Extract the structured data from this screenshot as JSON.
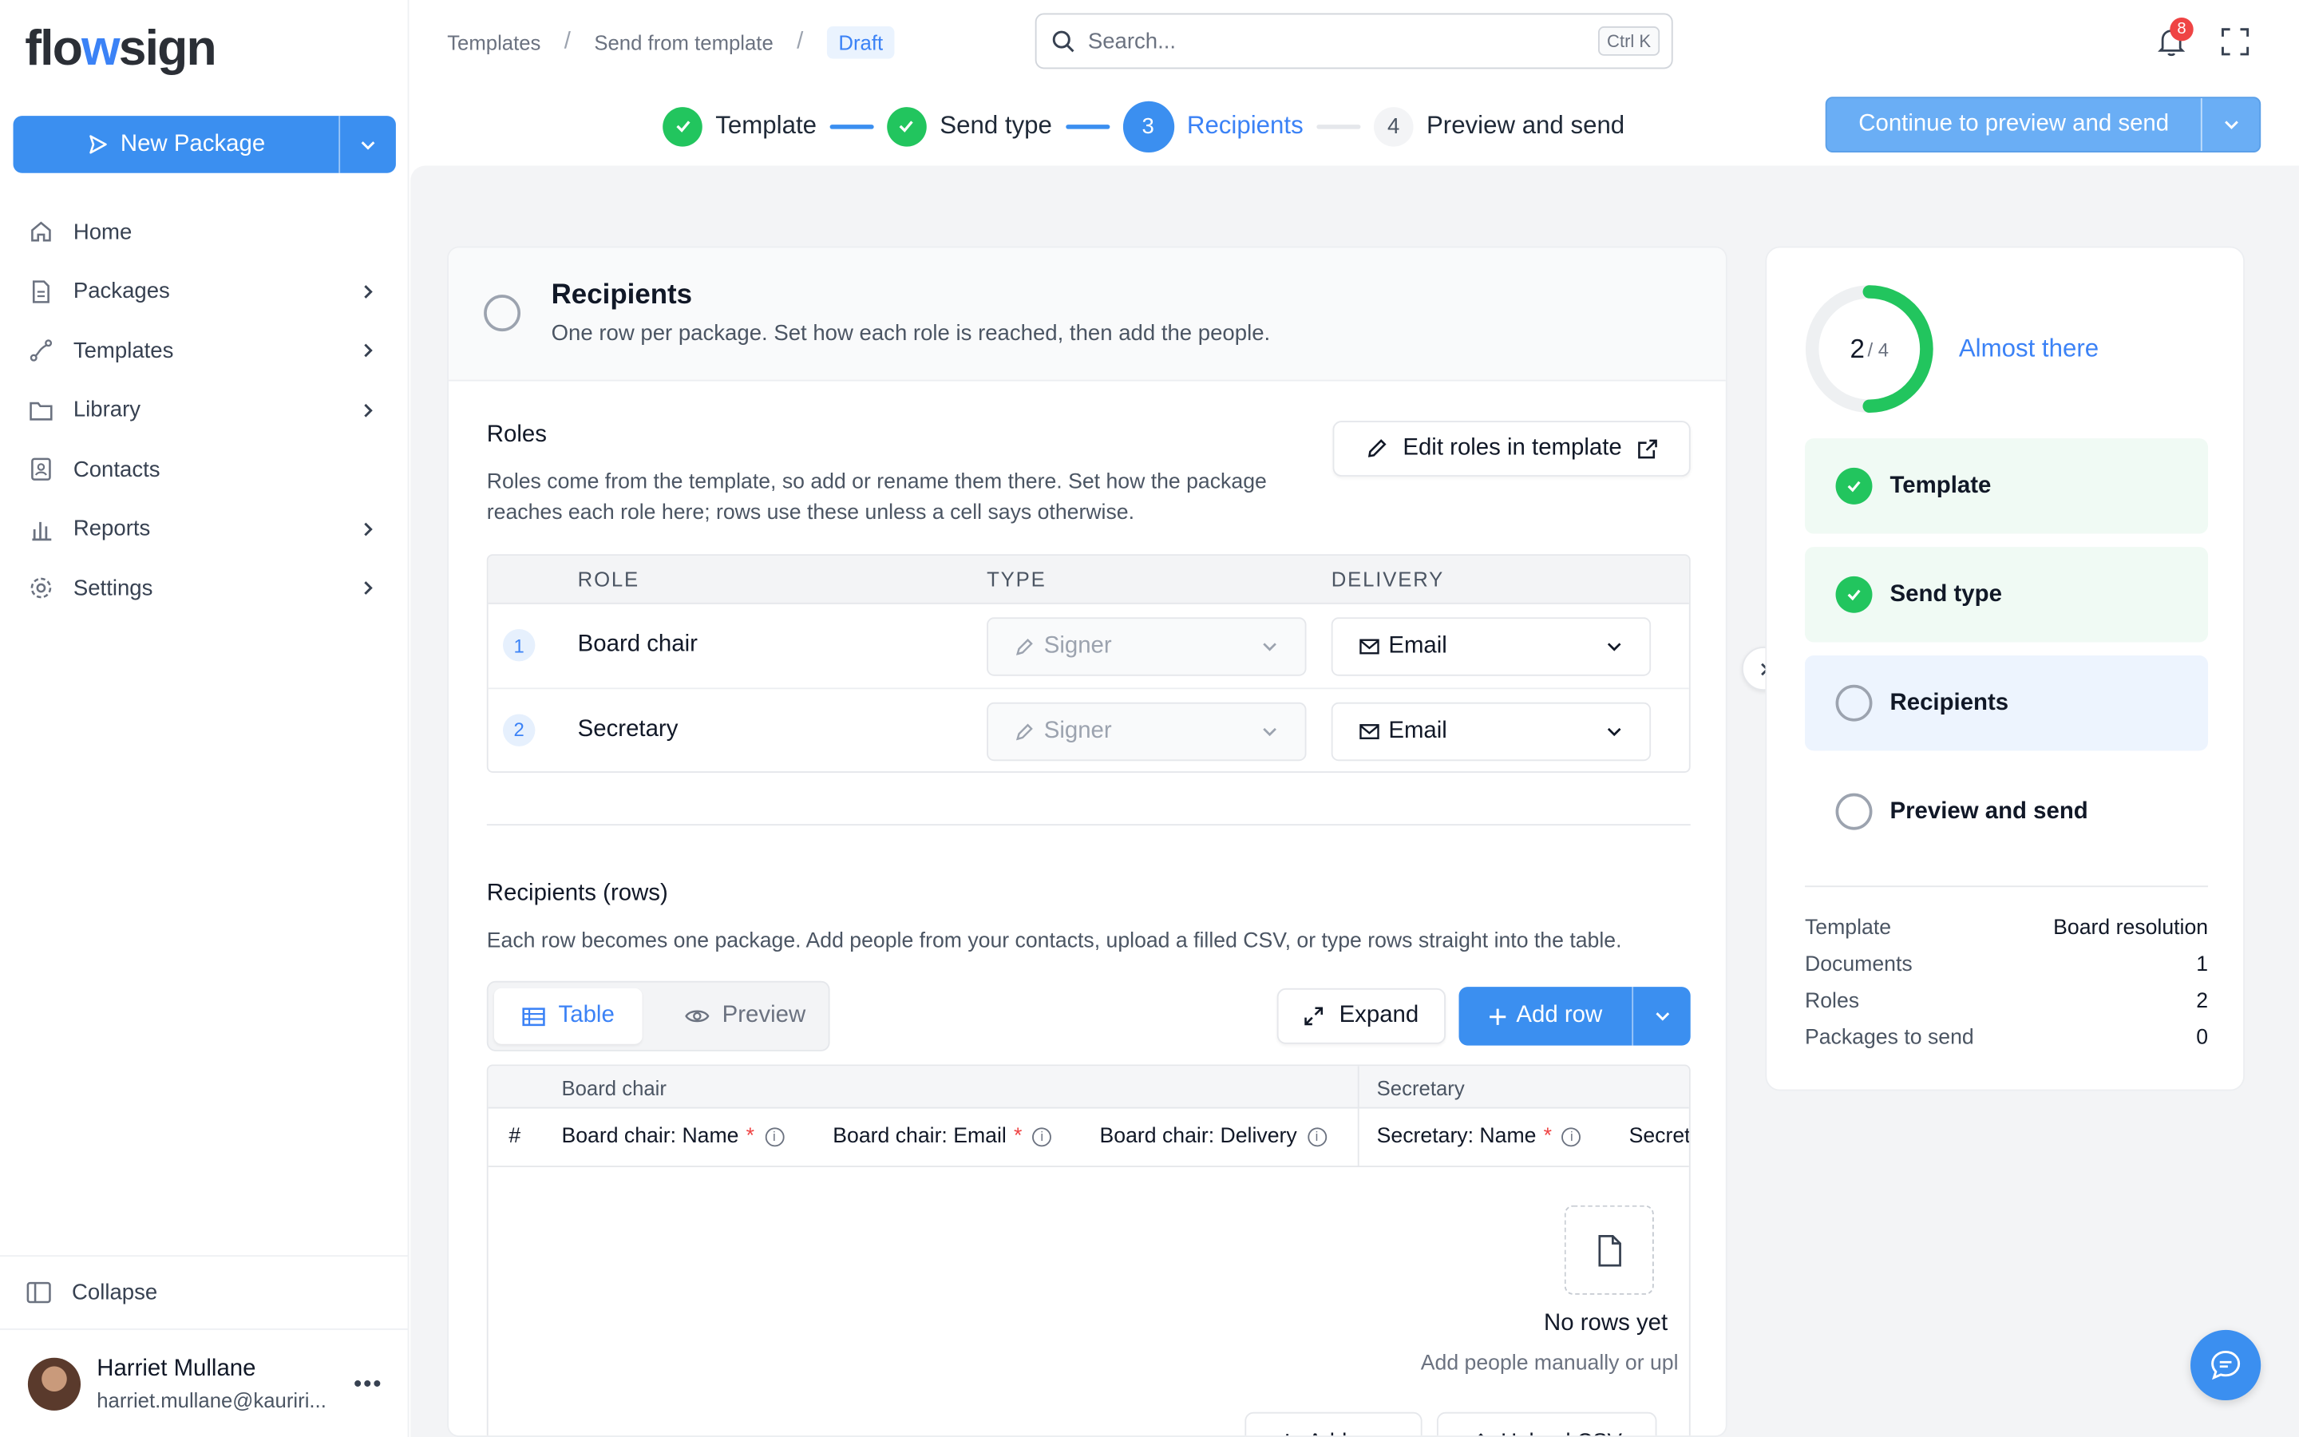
{
  "app": {
    "logo_prefix": "flo",
    "logo_w": "w",
    "logo_suffix": "sign"
  },
  "sidebar": {
    "new_package": "New Package",
    "items": [
      {
        "label": "Home",
        "icon": "home-icon",
        "has_chevron": false
      },
      {
        "label": "Packages",
        "icon": "document-icon",
        "has_chevron": true
      },
      {
        "label": "Templates",
        "icon": "route-icon",
        "has_chevron": true
      },
      {
        "label": "Library",
        "icon": "folder-icon",
        "has_chevron": true
      },
      {
        "label": "Contacts",
        "icon": "contact-book-icon",
        "has_chevron": false
      },
      {
        "label": "Reports",
        "icon": "bar-chart-icon",
        "has_chevron": true
      },
      {
        "label": "Settings",
        "icon": "gear-icon",
        "has_chevron": true
      }
    ],
    "collapse": "Collapse",
    "user": {
      "name": "Harriet Mullane",
      "email": "harriet.mullane@kauriri..."
    }
  },
  "header": {
    "breadcrumb": [
      "Templates",
      "Send from template",
      "Draft"
    ],
    "search_placeholder": "Search...",
    "search_shortcut": "Ctrl K",
    "notifications": "8"
  },
  "stepper": {
    "steps": [
      {
        "label": "Template",
        "state": "done"
      },
      {
        "label": "Send type",
        "state": "done"
      },
      {
        "number": "3",
        "label": "Recipients",
        "state": "current"
      },
      {
        "number": "4",
        "label": "Preview and send",
        "state": "todo"
      }
    ],
    "continue_label": "Continue to preview and send"
  },
  "recipients_card": {
    "title": "Recipients",
    "subtitle": "One row per package. Set how each role is reached, then add the people.",
    "roles": {
      "title": "Roles",
      "description": "Roles come from the template, so add or rename them there. Set how the package reaches each role here; rows use these unless a cell says otherwise.",
      "edit_button": "Edit roles in template",
      "columns": [
        "ROLE",
        "TYPE",
        "DELIVERY"
      ],
      "rows": [
        {
          "num": "1",
          "role": "Board chair",
          "type": "Signer",
          "delivery": "Email"
        },
        {
          "num": "2",
          "role": "Secretary",
          "type": "Signer",
          "delivery": "Email"
        }
      ]
    },
    "rows_section": {
      "title": "Recipients (rows)",
      "description": "Each row becomes one package. Add people from your contacts, upload a filled CSV, or type rows straight into the table.",
      "view_table": "Table",
      "view_preview": "Preview",
      "expand": "Expand",
      "add_row": "Add row",
      "groups": [
        "Board chair",
        "Secretary"
      ],
      "columns": [
        "#",
        "Board chair: Name",
        "Board chair: Email",
        "Board chair: Delivery",
        "Secretary: Name",
        "Secret"
      ],
      "empty_title": "No rows yet",
      "empty_subtitle": "Add people manually or upl",
      "empty_add": "Add row",
      "empty_upload": "Upload CSV"
    }
  },
  "progress_panel": {
    "done": "2",
    "total": "/ 4",
    "progress_fraction": 0.5,
    "status": "Almost there",
    "steps": [
      {
        "label": "Template",
        "state": "done"
      },
      {
        "label": "Send type",
        "state": "done"
      },
      {
        "label": "Recipients",
        "state": "current"
      },
      {
        "label": "Preview and send",
        "state": "todo"
      }
    ],
    "summary": [
      {
        "key": "Template",
        "value": "Board resolution"
      },
      {
        "key": "Documents",
        "value": "1"
      },
      {
        "key": "Roles",
        "value": "2"
      },
      {
        "key": "Packages to send",
        "value": "0"
      }
    ]
  },
  "colors": {
    "accent": "#3b8ff0",
    "success": "#22c55e",
    "danger": "#ef4444"
  }
}
